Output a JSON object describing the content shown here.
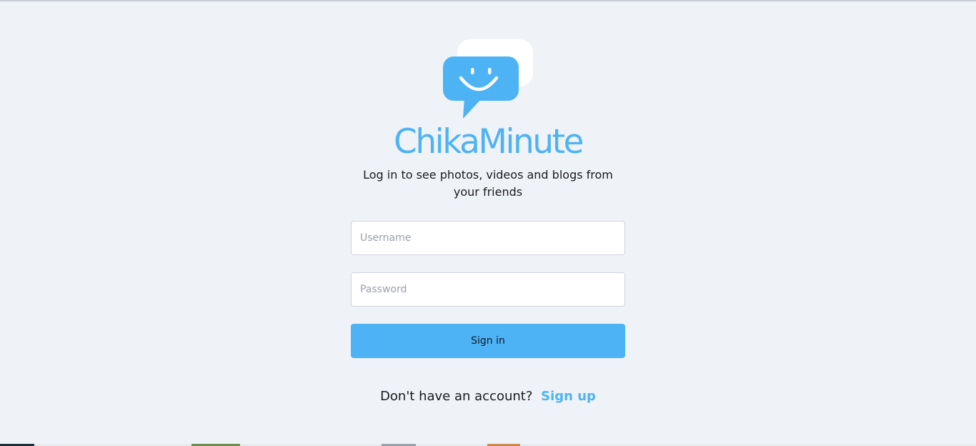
{
  "app": {
    "brand_name": "ChikaMinute",
    "logo_icon": "smiling-chat-bubble-icon",
    "tagline": "Log in to see photos, videos and blogs from your friends"
  },
  "form": {
    "username_placeholder": "Username",
    "username_value": "",
    "password_placeholder": "Password",
    "password_value": "",
    "signin_label": "Sign in"
  },
  "footer": {
    "prompt_text": "Don't have an account?",
    "signup_label": "Sign up"
  },
  "colors": {
    "accent": "#4db3f5",
    "background": "#eff2f7",
    "text": "#1b1b1b"
  }
}
